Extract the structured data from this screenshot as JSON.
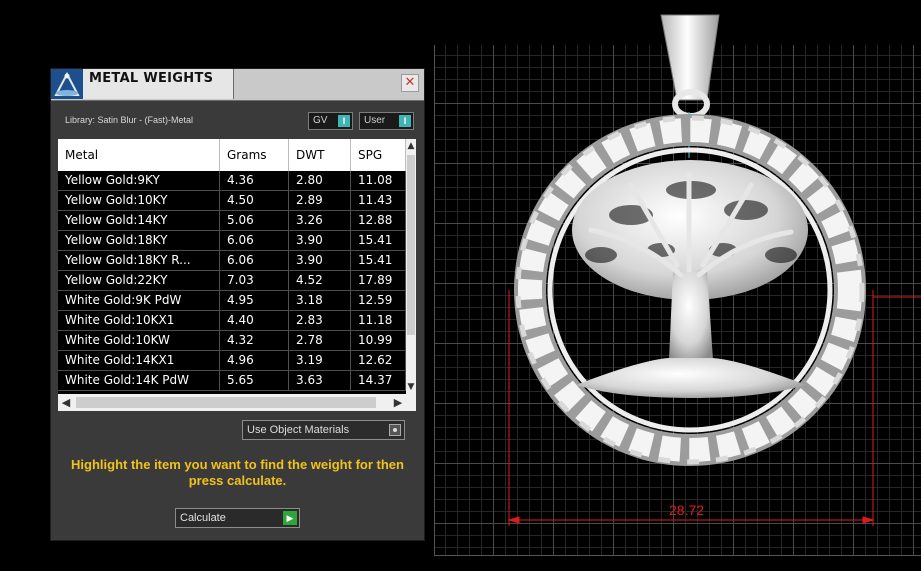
{
  "panel": {
    "title": "METAL WEIGHTS",
    "close_glyph": "✕",
    "library_label": "Library: Satin Blur - (Fast)-Metal",
    "gv_toggle": "GV",
    "user_toggle": "User",
    "toggle_knob": "I",
    "use_object_materials": "Use Object Materials",
    "instructions": "Highlight the item you want to find the weight for then press calculate.",
    "calculate_label": "Calculate",
    "accent_color": "#f2c21c"
  },
  "table": {
    "columns": [
      "Metal",
      "Grams",
      "DWT",
      "SPG"
    ],
    "rows": [
      [
        "Yellow Gold:9KY",
        "4.36",
        "2.80",
        "11.08"
      ],
      [
        "Yellow Gold:10KY",
        "4.50",
        "2.89",
        "11.43"
      ],
      [
        "Yellow Gold:14KY",
        "5.06",
        "3.26",
        "12.88"
      ],
      [
        "Yellow Gold:18KY",
        "6.06",
        "3.90",
        "15.41"
      ],
      [
        "Yellow Gold:18KY R...",
        "6.06",
        "3.90",
        "15.41"
      ],
      [
        "Yellow Gold:22KY",
        "7.03",
        "4.52",
        "17.89"
      ],
      [
        "White Gold:9K PdW",
        "4.95",
        "3.18",
        "12.59"
      ],
      [
        "White Gold:10KX1",
        "4.40",
        "2.83",
        "11.18"
      ],
      [
        "White Gold:10KW",
        "4.32",
        "2.78",
        "10.99"
      ],
      [
        "White Gold:14KX1",
        "4.96",
        "3.19",
        "12.62"
      ],
      [
        "White Gold:14K PdW",
        "5.65",
        "3.63",
        "14.37"
      ]
    ]
  },
  "viewport": {
    "dimension": "28.72",
    "dimension_color": "#e01a1a"
  }
}
